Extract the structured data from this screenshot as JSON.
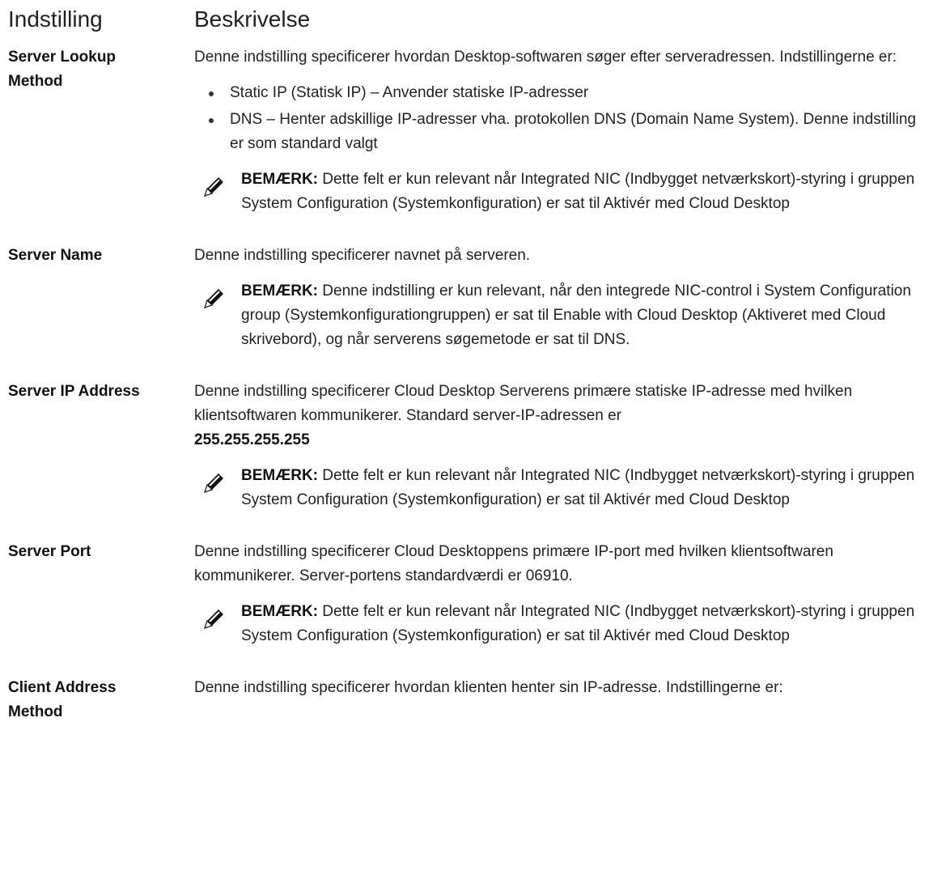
{
  "header": {
    "col1": "Indstilling",
    "col2": "Beskrivelse"
  },
  "rows": [
    {
      "term_line1": "Server Lookup",
      "term_line2": "Method",
      "desc": "Denne indstilling specificerer hvordan Desktop-softwaren søger efter serveradressen. Indstillingerne er:",
      "bullets": [
        "Static IP (Statisk IP) – Anvender statiske IP-adresser",
        "DNS – Henter adskillige IP-adresser vha. protokollen DNS (Domain Name System). Denne indstilling er som standard valgt"
      ],
      "note_label": "BEMÆRK:",
      "note_text": "Dette felt er kun relevant når Integrated NIC (Indbygget netværkskort)-styring i gruppen System Configuration (Systemkonfiguration) er sat til Aktivér med Cloud Desktop"
    },
    {
      "term_line1": "Server Name",
      "desc": "Denne indstilling specificerer navnet på serveren.",
      "note_label": "BEMÆRK:",
      "note_text": "Denne indstilling er kun relevant, når den integrede NIC-control i System Configuration group (Systemkonfigurationgruppen) er sat til Enable with Cloud Desktop (Aktiveret med Cloud skrivebord), og når serverens søgemetode er sat til DNS."
    },
    {
      "term_line1": "Server IP Address",
      "desc": "Denne indstilling specificerer Cloud Desktop Serverens primære statiske IP-adresse med hvilken klientsoftwaren kommunikerer. Standard server-IP-adressen er",
      "desc_value": "255.255.255.255",
      "note_label": "BEMÆRK:",
      "note_text": "Dette felt er kun relevant når Integrated NIC (Indbygget netværkskort)-styring i gruppen System Configuration (Systemkonfiguration) er sat til Aktivér med Cloud Desktop"
    },
    {
      "term_line1": "Server Port",
      "desc": "Denne indstilling specificerer Cloud Desktoppens primære IP-port med hvilken klientsoftwaren kommunikerer. Server-portens standardværdi er 06910.",
      "note_label": "BEMÆRK:",
      "note_text": "Dette felt er kun relevant når Integrated NIC (Indbygget netværkskort)-styring i gruppen System Configuration (Systemkonfiguration) er sat til Aktivér med Cloud Desktop"
    },
    {
      "term_line1": "Client Address",
      "term_line2": "Method",
      "desc": "Denne indstilling specificerer hvordan klienten henter sin IP-adresse. Indstillingerne er:"
    }
  ]
}
